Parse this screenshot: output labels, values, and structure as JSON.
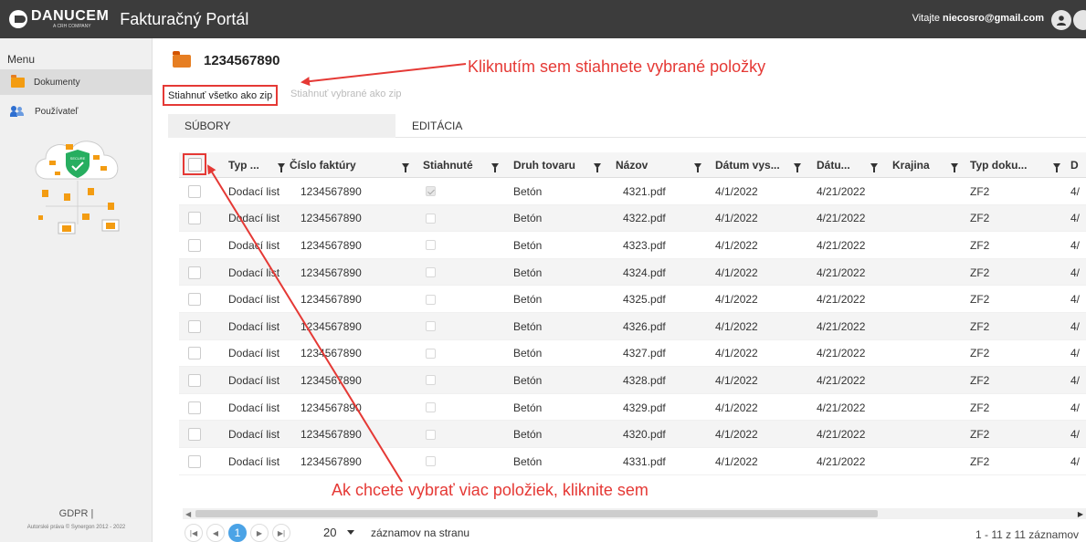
{
  "topbar": {
    "brand": "DANUCEM",
    "brand_sub": "A CRH COMPANY",
    "app_title": "Fakturačný Portál",
    "welcome_prefix": "Vitajte ",
    "user_email": "niecosro@gmail.com"
  },
  "sidebar": {
    "menu_title": "Menu",
    "items": [
      {
        "label": "Dokumenty",
        "icon": "folder-icon",
        "active": true
      },
      {
        "label": "Používateľ",
        "icon": "users-icon",
        "active": false
      }
    ],
    "illustration_badge": "SECURE",
    "gdpr": "GDPR |",
    "copyright": "Autorské práva © Synergon 2012 - 2022"
  },
  "main": {
    "doc_title": "1234567890",
    "btn_zip_all": "Stiahnuť všetko ako zip",
    "btn_zip_selected": "Stiahnuť vybrané ako zip",
    "annotation_top": "Kliknutím sem stiahnete vybrané položky",
    "annotation_bottom": "Ak chcete vybrať viac položiek, kliknite sem",
    "tabs": [
      {
        "label": "SÚBORY"
      },
      {
        "label": "EDITÁCIA"
      }
    ]
  },
  "grid": {
    "columns": [
      {
        "label": "Typ ..."
      },
      {
        "label": "Číslo faktúry"
      },
      {
        "label": "Stiahnuté"
      },
      {
        "label": "Druh tovaru"
      },
      {
        "label": "Názov"
      },
      {
        "label": "Dátum vys..."
      },
      {
        "label": "Dátu..."
      },
      {
        "label": "Krajina"
      },
      {
        "label": "Typ doku..."
      },
      {
        "label": "D"
      }
    ],
    "rows": [
      {
        "type": "Dodací list",
        "invoice": "1234567890",
        "downloaded": true,
        "goods": "Betón",
        "name": "4321.pdf",
        "issue_date": "4/1/2022",
        "date2": "4/21/2022",
        "country": "",
        "doc_type": "ZF2",
        "d": "4/"
      },
      {
        "type": "Dodací list",
        "invoice": "1234567890",
        "downloaded": false,
        "goods": "Betón",
        "name": "4322.pdf",
        "issue_date": "4/1/2022",
        "date2": "4/21/2022",
        "country": "",
        "doc_type": "ZF2",
        "d": "4/"
      },
      {
        "type": "Dodací list",
        "invoice": "1234567890",
        "downloaded": false,
        "goods": "Betón",
        "name": "4323.pdf",
        "issue_date": "4/1/2022",
        "date2": "4/21/2022",
        "country": "",
        "doc_type": "ZF2",
        "d": "4/"
      },
      {
        "type": "Dodací list",
        "invoice": "1234567890",
        "downloaded": false,
        "goods": "Betón",
        "name": "4324.pdf",
        "issue_date": "4/1/2022",
        "date2": "4/21/2022",
        "country": "",
        "doc_type": "ZF2",
        "d": "4/"
      },
      {
        "type": "Dodací list",
        "invoice": "1234567890",
        "downloaded": false,
        "goods": "Betón",
        "name": "4325.pdf",
        "issue_date": "4/1/2022",
        "date2": "4/21/2022",
        "country": "",
        "doc_type": "ZF2",
        "d": "4/"
      },
      {
        "type": "Dodací list",
        "invoice": "1234567890",
        "downloaded": false,
        "goods": "Betón",
        "name": "4326.pdf",
        "issue_date": "4/1/2022",
        "date2": "4/21/2022",
        "country": "",
        "doc_type": "ZF2",
        "d": "4/"
      },
      {
        "type": "Dodací list",
        "invoice": "1234567890",
        "downloaded": false,
        "goods": "Betón",
        "name": "4327.pdf",
        "issue_date": "4/1/2022",
        "date2": "4/21/2022",
        "country": "",
        "doc_type": "ZF2",
        "d": "4/"
      },
      {
        "type": "Dodací list",
        "invoice": "1234567890",
        "downloaded": false,
        "goods": "Betón",
        "name": "4328.pdf",
        "issue_date": "4/1/2022",
        "date2": "4/21/2022",
        "country": "",
        "doc_type": "ZF2",
        "d": "4/"
      },
      {
        "type": "Dodací list",
        "invoice": "1234567890",
        "downloaded": false,
        "goods": "Betón",
        "name": "4329.pdf",
        "issue_date": "4/1/2022",
        "date2": "4/21/2022",
        "country": "",
        "doc_type": "ZF2",
        "d": "4/"
      },
      {
        "type": "Dodací list",
        "invoice": "1234567890",
        "downloaded": false,
        "goods": "Betón",
        "name": "4320.pdf",
        "issue_date": "4/1/2022",
        "date2": "4/21/2022",
        "country": "",
        "doc_type": "ZF2",
        "d": "4/"
      },
      {
        "type": "Dodací list",
        "invoice": "1234567890",
        "downloaded": false,
        "goods": "Betón",
        "name": "4331.pdf",
        "issue_date": "4/1/2022",
        "date2": "4/21/2022",
        "country": "",
        "doc_type": "ZF2",
        "d": "4/"
      }
    ]
  },
  "pager": {
    "current_page": "1",
    "page_size": "20",
    "page_size_label": "záznamov na stranu",
    "info": "1 - 11 z 11 záznamov"
  },
  "colors": {
    "topbar_bg": "#3c3c3c",
    "annotation": "#e53935",
    "accent_blue": "#4ba3e6",
    "folder_orange": "#e67e22"
  }
}
